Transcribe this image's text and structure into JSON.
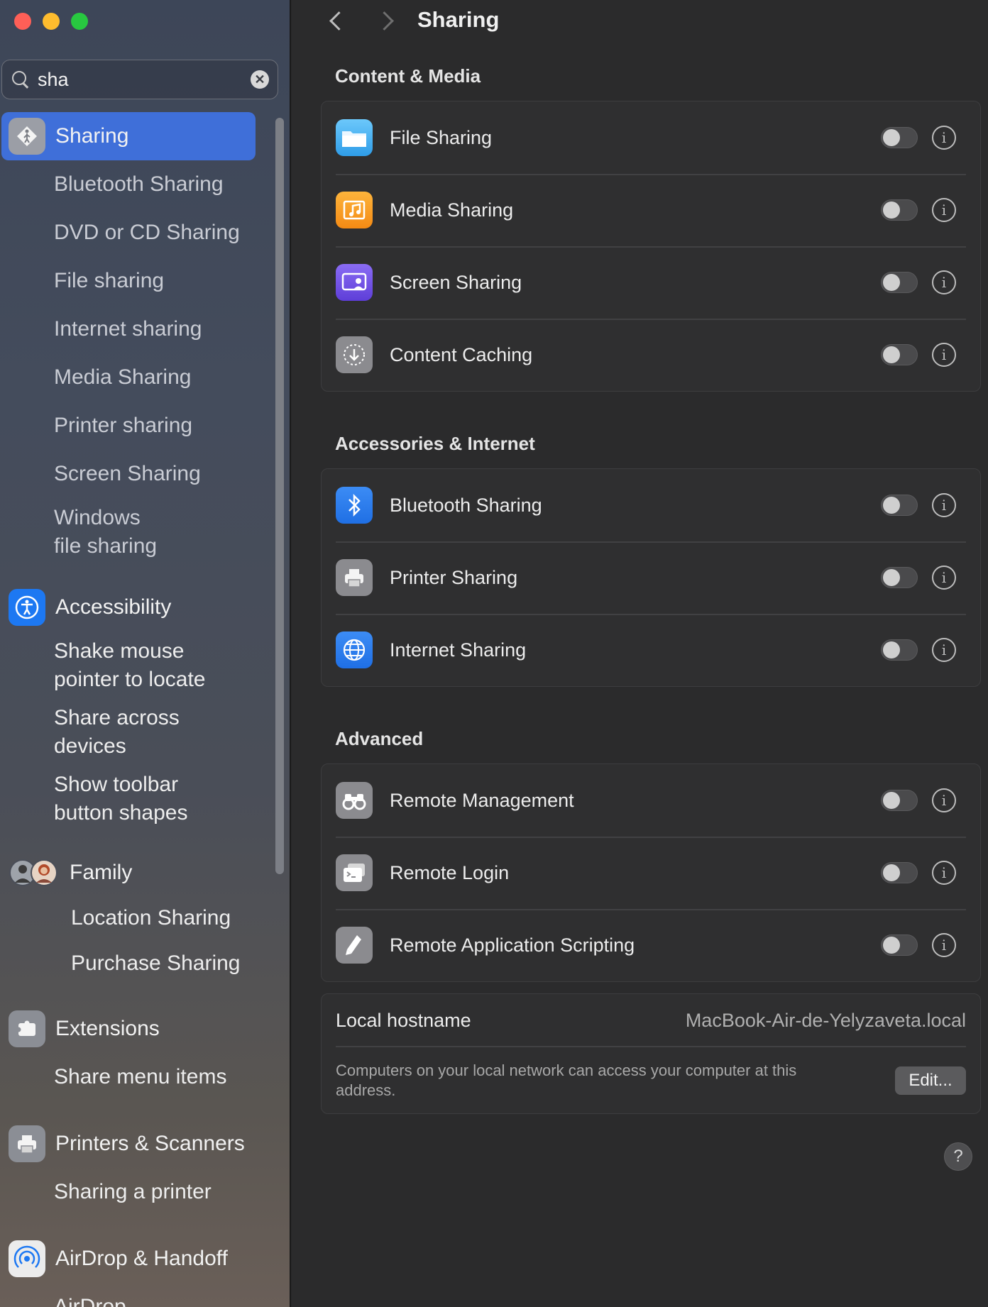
{
  "search": {
    "value": "sha"
  },
  "sidebar": {
    "selected": {
      "label": "Sharing",
      "icon": "sharing-icon"
    },
    "sharing_subitems": [
      "Bluetooth Sharing",
      "DVD or CD Sharing",
      "File sharing",
      "Internet sharing",
      "Media Sharing",
      "Printer sharing",
      "Screen Sharing",
      "Windows\nfile sharing"
    ],
    "accessibility": {
      "label": "Accessibility",
      "icon": "accessibility-icon",
      "subitems": [
        "Shake mouse\npointer to locate",
        "Share across\ndevices",
        "Show toolbar\nbutton shapes"
      ]
    },
    "family": {
      "label": "Family",
      "icon": "family-avatars-icon",
      "subitems": [
        "Location Sharing",
        "Purchase Sharing"
      ]
    },
    "extensions": {
      "label": "Extensions",
      "icon": "extensions-icon",
      "subitems": [
        "Share menu items"
      ]
    },
    "printers": {
      "label": "Printers & Scanners",
      "icon": "printer-icon",
      "subitems": [
        "Sharing a printer"
      ]
    },
    "airdrop": {
      "label": "AirDrop & Handoff",
      "icon": "airdrop-icon",
      "subitems": [
        "AirDrop"
      ]
    }
  },
  "header": {
    "title": "Sharing"
  },
  "sections": {
    "content_media": {
      "title": "Content & Media",
      "rows": [
        {
          "label": "File Sharing",
          "icon": "folder-icon",
          "enabled": false
        },
        {
          "label": "Media Sharing",
          "icon": "music-icon",
          "enabled": false
        },
        {
          "label": "Screen Sharing",
          "icon": "screen-sharing-icon",
          "enabled": false
        },
        {
          "label": "Content Caching",
          "icon": "download-icon",
          "enabled": false
        }
      ]
    },
    "accessories_internet": {
      "title": "Accessories & Internet",
      "rows": [
        {
          "label": "Bluetooth Sharing",
          "icon": "bluetooth-icon",
          "enabled": false
        },
        {
          "label": "Printer Sharing",
          "icon": "printer-icon",
          "enabled": false
        },
        {
          "label": "Internet Sharing",
          "icon": "globe-icon",
          "enabled": false
        }
      ]
    },
    "advanced": {
      "title": "Advanced",
      "rows": [
        {
          "label": "Remote Management",
          "icon": "binoculars-icon",
          "enabled": false
        },
        {
          "label": "Remote Login",
          "icon": "terminal-icon",
          "enabled": false
        },
        {
          "label": "Remote Application Scripting",
          "icon": "script-icon",
          "enabled": false
        }
      ]
    }
  },
  "hostname": {
    "label": "Local hostname",
    "value": "MacBook-Air-de-Yelyzaveta.local",
    "description": "Computers on your local network can access your computer at this address.",
    "edit_label": "Edit..."
  },
  "info_glyph": "i",
  "help_glyph": "?",
  "clear_glyph": "✕"
}
